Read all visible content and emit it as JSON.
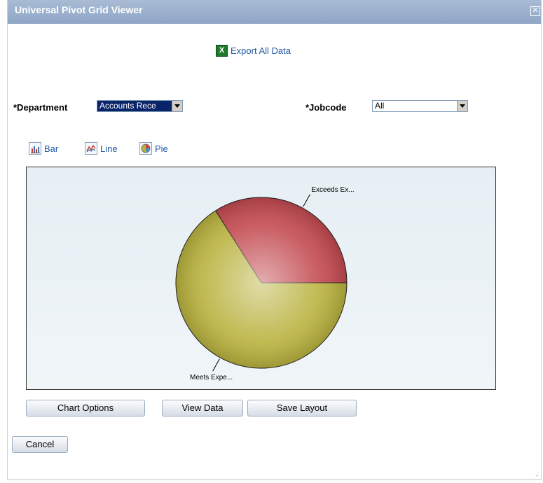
{
  "dialog": {
    "title": "Universal Pivot Grid Viewer"
  },
  "export": {
    "label": "Export All Data",
    "icon": "excel-icon"
  },
  "filters": {
    "department": {
      "label": "*Department",
      "value": "Accounts Rece"
    },
    "jobcode": {
      "label": "*Jobcode",
      "value": "All"
    }
  },
  "chart_types": [
    {
      "label": "Bar",
      "icon": "bar-chart-icon"
    },
    {
      "label": "Line",
      "icon": "line-chart-icon"
    },
    {
      "label": "Pie",
      "icon": "pie-chart-icon"
    }
  ],
  "chart_data": {
    "type": "pie",
    "slices": [
      {
        "label": "Exceeds Ex...",
        "value": 34,
        "color": "#c2494f"
      },
      {
        "label": "Meets Expe...",
        "value": 66,
        "color": "#b9b23e"
      }
    ]
  },
  "buttons": {
    "chart_options": "Chart Options",
    "view_data": "View Data",
    "save_layout": "Save Layout",
    "cancel": "Cancel"
  }
}
